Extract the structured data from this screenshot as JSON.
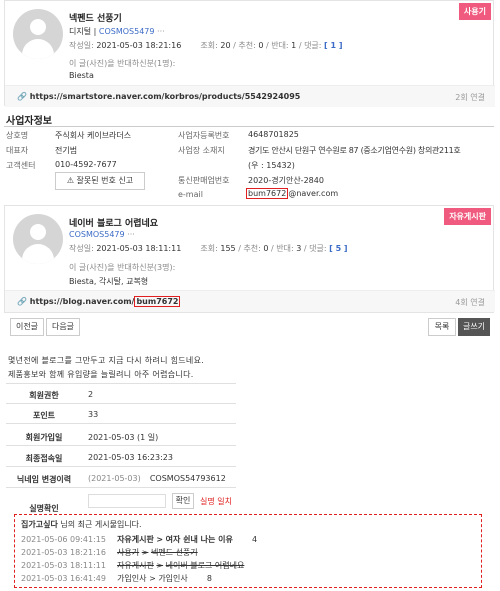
{
  "post1": {
    "tag": "사용기",
    "title": "넥펜드 선풍기",
    "board": "디지털",
    "sep": "|",
    "author": "COSMOS5479",
    "date_label": "작성일:",
    "date": "2021-05-03 18:21:16",
    "views_label": "조회:",
    "views": "20",
    "rec_label": "추천:",
    "rec": "0",
    "opp_label": "반대:",
    "opp": "1",
    "comments_label": "댓글:",
    "comments": "[ 1 ]",
    "opposers_line": "이 글(사진)을 반대하신분(1명):",
    "opposers": "Biesta",
    "link_url": "https://smartstore.naver.com/korbros/products/5542924095",
    "link_count": "2회 연결"
  },
  "business": {
    "heading": "사업자정보",
    "rows": [
      {
        "label": "상호명",
        "value": "주식회사 케이브라더스",
        "label2": "사업자등록번호",
        "value2": "4648701825"
      },
      {
        "label": "대표자",
        "value": "전기범",
        "label2": "사업장 소재지",
        "value2": "경기도 안산시 단원구 연수원로 87 (중소기업연수원) 창의관211호"
      },
      {
        "label": "고객센터",
        "value": "010-4592-7677",
        "label2": "",
        "value2": "(우 : 15432)"
      },
      {
        "label": "",
        "value": "",
        "label2": "통신판매업번호",
        "value2": "2020-경기안산-2840"
      }
    ],
    "report_button": "잘못된 번호 신고",
    "email_label": "e-mail",
    "email_user": "bum7672",
    "email_domain": "@naver.com"
  },
  "post2": {
    "tag": "자유게시판",
    "title": "네이버 블로그 어렵네요",
    "author": "COSMOS5479",
    "date_label": "작성일:",
    "date": "2021-05-03 18:11:11",
    "views_label": "조회:",
    "views": "155",
    "rec_label": "추천:",
    "rec": "0",
    "opp_label": "반대:",
    "opp": "3",
    "comments_label": "댓글:",
    "comments": "[ 5 ]",
    "opposers_line": "이 글(사진)을 반대하신분(3명):",
    "opposers": "Biesta, 각시탈, 교복형",
    "link_url_prefix": "https://blog.naver.com/",
    "link_url_user": "bum7672",
    "link_count": "4회 연결",
    "prev_button": "이전글",
    "next_button": "다음글",
    "list_button": "목록",
    "write_button": "글쓰기",
    "body_line1": "몇년전에 블로그를 그만두고 지금 다시 하려니 힘드네요.",
    "body_line2": "제품홍보와 함께 유입량을 늘릴려니 아주 어렵습니다."
  },
  "member": {
    "rows": [
      {
        "label": "회원권한",
        "value": "2"
      },
      {
        "label": "포인트",
        "value": "33"
      },
      {
        "label": "회원가입일",
        "value": "2021-05-03 (1 일)"
      },
      {
        "label": "최종접속일",
        "value": "2021-05-03 16:23:23"
      }
    ],
    "nick_history_label": "닉네임 변경이력",
    "nick_history_date": "(2021-05-03)",
    "nick_history_value": "COSMOS54793612",
    "verify_label": "실명확인",
    "verify_button": "확인",
    "verify_status": "실명 일치"
  },
  "recent": {
    "title_name": "집가고싶다",
    "title_suffix": "님의 최근 게시물입니다.",
    "items": [
      {
        "date": "2021-05-06 09:41:15",
        "board": "자유게시판",
        "arrow": ">",
        "title": "여자 쉰내 나는 이유",
        "count": "4",
        "bold": true,
        "strike": false
      },
      {
        "date": "2021-05-03 18:21:16",
        "board": "사용기",
        "arrow": ">",
        "title": "넥펜드 선풍기",
        "count": "",
        "bold": false,
        "strike": true
      },
      {
        "date": "2021-05-03 18:11:11",
        "board": "자유게시판",
        "arrow": ">",
        "title": "네이버 블로그 어렵네요",
        "count": "",
        "bold": false,
        "strike": true
      },
      {
        "date": "2021-05-03 16:41:49",
        "board": "가입인사",
        "arrow": ">",
        "title": "가입인사",
        "count": "8",
        "bold": false,
        "strike": false
      }
    ]
  },
  "colors": {
    "tag": "#f05a7e",
    "link_blue": "#3b6bc6",
    "red_box": "#e02020",
    "verify_red": "#e02020"
  }
}
